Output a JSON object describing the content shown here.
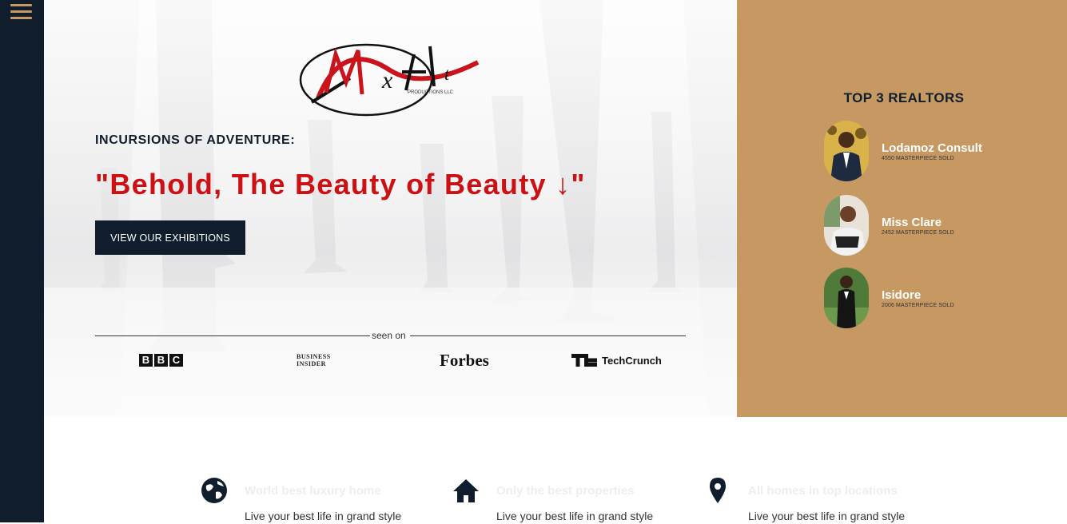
{
  "logo": {
    "main": "MaxArt",
    "sub": "PRODUCTIONS LLC"
  },
  "hero": {
    "kicker": "INCURSIONS OF ADVENTURE:",
    "headline": "\"Behold, The Beauty of Beauty ↓\"",
    "cta_label": "VIEW OUR EXHIBITIONS",
    "seen_on": "seen on",
    "brands": {
      "bbc": [
        "B",
        "B",
        "C"
      ],
      "business_insider": [
        "BUSINESS",
        "INSIDER"
      ],
      "forbes": "Forbes",
      "techcrunch": "TechCrunch"
    }
  },
  "realtors": {
    "title": "TOP 3 REALTORS",
    "items": [
      {
        "name": "Lodamoz Consult",
        "sold": "4550 MASTERPIECE SOLD"
      },
      {
        "name": "Miss Clare",
        "sold": "2452 MASTERPIECE SOLD"
      },
      {
        "name": "Isidore",
        "sold": "2006 MASTERPIECE SOLD"
      }
    ]
  },
  "features": [
    {
      "icon": "globe-icon",
      "title": "World best luxury home",
      "desc": "Live your best life in grand style"
    },
    {
      "icon": "home-icon",
      "title": "Only the best properties",
      "desc": "Live your best life in grand style"
    },
    {
      "icon": "map-pin-icon",
      "title": "All homes in top locations",
      "desc": "Live your best life in grand style"
    }
  ],
  "colors": {
    "navy": "#101d2c",
    "gold": "#c69963",
    "red": "#cc1014"
  }
}
